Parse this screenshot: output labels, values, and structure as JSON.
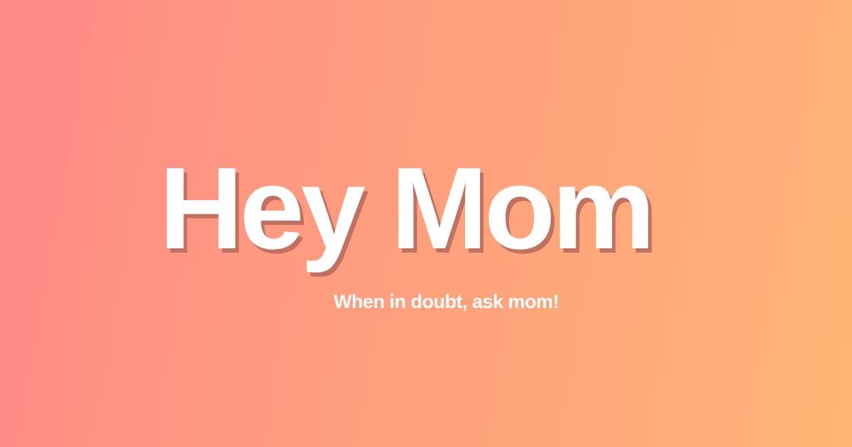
{
  "hero": {
    "title": "Hey Mom",
    "tagline": "When in doubt, ask mom!"
  },
  "colors": {
    "gradient_start": "#ff8888",
    "gradient_end": "#ffb676",
    "text": "#ffffff",
    "shadow": "#c27060"
  }
}
